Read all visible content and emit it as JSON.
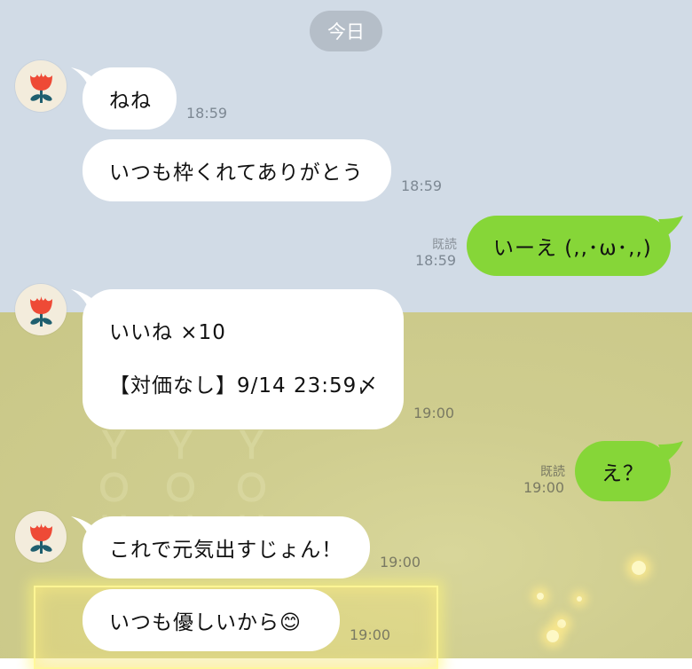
{
  "date_label": "今日",
  "messages": [
    {
      "side": "in",
      "text": "ねね",
      "time": "18:59"
    },
    {
      "side": "in",
      "text": "いつも枠くれてありがとう",
      "time": "18:59"
    },
    {
      "side": "out",
      "text": "いーえ (,,･ω･,,)",
      "time": "18:59",
      "read": "既読"
    },
    {
      "side": "in",
      "lines": [
        "いいね ×10",
        "",
        "【対価なし】9/14 23:59〆"
      ],
      "time": "19:00"
    },
    {
      "side": "out",
      "text": "え？",
      "time": "19:00",
      "read": "既読"
    },
    {
      "side": "in",
      "text": "これで元気出すじょん！",
      "time": "19:00"
    },
    {
      "side": "in",
      "text": "いつも優しいから😊",
      "time": "19:00"
    }
  ],
  "avatar_icon": "red-tulip-icon",
  "colors": {
    "incoming_bubble": "#ffffff",
    "outgoing_bubble": "#86d638",
    "top_background": "#d1dbe6",
    "bottom_background": "#cfcd8f"
  }
}
